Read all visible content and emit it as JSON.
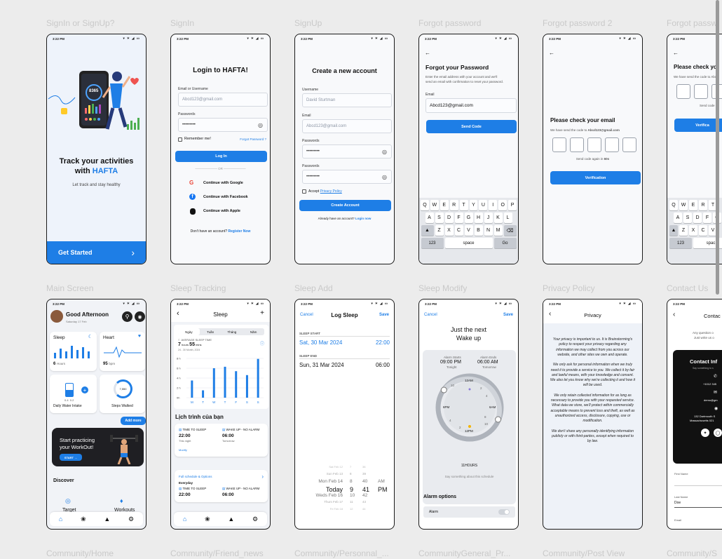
{
  "frames": {
    "f1": "SignIn or SignUp?",
    "f2": "SignIn",
    "f3": "SignUp",
    "f4": "Forgot password",
    "f5": "Forgot password 2",
    "f6": "Forgot passw",
    "f7": "Main Screen",
    "f8": "Sleep Tracking",
    "f9": "Sleep Add",
    "f10": "Sleep Modify",
    "f11": "Privacy Policy",
    "f12": "Contact Us",
    "b1": "Community/Home",
    "b2": "Community/Friend_news",
    "b3": "Community/Personnal_...",
    "b4": "CommunityGeneral_Pr...",
    "b5": "Community/Post View",
    "b6": "Community/S"
  },
  "status": {
    "time": "3:22 PM",
    "icons": "▾ ✶ ◢ ▭"
  },
  "welcome": {
    "watch_num": "8365",
    "title1": "Track your activities",
    "title2": "with",
    "brand": "HAFTA",
    "subtitle": "Let track and stay healthy",
    "cta": "Get Started",
    "cta_arrow": "›"
  },
  "signin": {
    "title": "Login to HAFTA!",
    "email_label": "Email or Username",
    "email_value": "Abcd123@gmail.com",
    "pw_label": "Passwords",
    "pw_value": "•••••••••",
    "remember": "Remember me!",
    "forgot": "Forgot Password ?",
    "login": "Log In",
    "or": "OR",
    "google": "Continue with Google",
    "facebook": "Continue with Facebook",
    "apple": "Continue with Apple",
    "noacc": "Don't have an account?",
    "register": "Register Now"
  },
  "signup": {
    "title": "Create a new account",
    "username_label": "Username",
    "username_value": "David Sturtman",
    "email_label": "Email",
    "email_value": "Abcd123@gmail.com",
    "pw_label": "Passwords",
    "pw_value": "•••••••••",
    "pw2_label": "Passwords",
    "pw2_value": "•••••••••",
    "accept": "Accept",
    "privacy": "Privacy Policy",
    "create": "Create Account",
    "have": "Already have an account?",
    "login": "Login now"
  },
  "forgot": {
    "back": "←",
    "title": "Forgot your Password",
    "desc1": "Enter the email address with your account and we'll",
    "desc2": "send an email with confirmation to reset your password.",
    "email_label": "Email",
    "email_value": "Abcd123@gmail.com",
    "send": "Send Code"
  },
  "keyboard": {
    "row1": [
      "Q",
      "W",
      "E",
      "R",
      "T",
      "Y",
      "U",
      "I",
      "O",
      "P"
    ],
    "row2": [
      "A",
      "S",
      "D",
      "F",
      "G",
      "H",
      "J",
      "K",
      "L"
    ],
    "row3": [
      "Z",
      "X",
      "C",
      "V",
      "B",
      "N",
      "M"
    ],
    "shift": "▲",
    "del": "⌫",
    "num": "123",
    "space": "space",
    "go": "Go"
  },
  "forgot2": {
    "back": "←",
    "title": "Please check your email",
    "desc": "We have send the code to",
    "email": "Abcd123@gmail.com",
    "resend": "Send code again in",
    "secs": "60s",
    "verify": "Verification"
  },
  "forgot3": {
    "back": "←",
    "title": "Please check yo",
    "desc": "We have send the code to Abcd",
    "resend": "Send code ag",
    "verify": "Verifica",
    "row1": [
      "Q",
      "W",
      "E",
      "R",
      "T"
    ],
    "row2": [
      "A",
      "S",
      "D",
      "F",
      "G"
    ],
    "row3": [
      "Z",
      "X",
      "C",
      "V"
    ],
    "num": "123",
    "space": "spac"
  },
  "main": {
    "greet": "Good Afternoon",
    "date": "Saturday 17 Feb",
    "sleep": "Sleep",
    "sleep_val": "6",
    "sleep_unit": "Hours",
    "heart": "Heart",
    "heart_val": "95",
    "heart_unit": "bpm",
    "water_a": "0.4",
    "water_b": "0.2",
    "water": "Daily Water Intake",
    "steps_num": "7,550",
    "steps": "Steps Walked",
    "add_more": "Add more",
    "work1": "Start practicing",
    "work2": "your WorkOut!",
    "start": "START →",
    "discover": "Discover",
    "target": "Target",
    "workouts": "Workouts"
  },
  "nav": {
    "home": "⌂",
    "paw": "❀",
    "user": "▲",
    "gear": "⚙"
  },
  "sleep": {
    "back": "‹",
    "title": "Sleep",
    "add": "+",
    "tabs": [
      "Ngày",
      "Tuần",
      "Tháng",
      "Năm"
    ],
    "avg_label": "AVERAGE SLEEP TIME",
    "avg_h": "7",
    "hours": "hours",
    "avg_m": "55",
    "mins": "mins",
    "range": "24 - 30 Month, 2024",
    "yticks": [
      "8 h",
      "6 h",
      "4 h",
      "2 h",
      "0h"
    ],
    "xticks": [
      "M",
      "T",
      "W",
      "T",
      "F",
      "S",
      "S"
    ],
    "schedule_title": "Lịch trình của bạn",
    "c1_sleep": "TIME TO SLEEP",
    "c1_wake": "WAKE UP - NO ALARM",
    "c1_t1": "22:00",
    "c1_t2": "06:00",
    "c1_d1": "This night",
    "c1_d2": "Tomorrow",
    "modify": "Modify",
    "full": "Full schedule & Options",
    "everyday": "Everyday",
    "c2_t1": "22:00",
    "c2_t2": "06:00"
  },
  "sleep_chart": {
    "type": "bar",
    "categories": [
      "M",
      "T",
      "W",
      "T",
      "F",
      "S",
      "S"
    ],
    "values": [
      3.5,
      1.5,
      6.0,
      6.3,
      5.4,
      4.6,
      7.9
    ],
    "ylim": [
      0,
      8
    ]
  },
  "sleepadd": {
    "cancel": "Cancel",
    "title": "Log Sleep",
    "save": "Save",
    "start_label": "SLEEP START",
    "start_date": "Sat, 30 Mar 2024",
    "start_time": "22:00",
    "end_label": "SLEEP END",
    "end_date": "Sun, 31 Mar 2024",
    "end_time": "06:00",
    "picker": [
      [
        "Sat Feb 12",
        "7",
        "38",
        ""
      ],
      [
        "Sun Feb 13",
        "8",
        "39",
        ""
      ],
      [
        "Mon Feb 14",
        "8",
        "40",
        "AM"
      ],
      [
        "Today",
        "9",
        "41",
        "PM"
      ],
      [
        "Weds Feb 16",
        "10",
        "42",
        ""
      ],
      [
        "Thurs Feb 17",
        "11",
        "43",
        ""
      ],
      [
        "Fri Feb 18",
        "12",
        "44",
        ""
      ]
    ]
  },
  "sleepmod": {
    "cancel": "Cancel",
    "save": "Save",
    "title1": "Just the next",
    "title2": "Wake up",
    "a_starts": "Alarm Starts",
    "a_ends": "Alarm Ends",
    "start_t": "09:00 PM",
    "end_t": "06:00 AM",
    "tonight": "Tonight",
    "tomorrow": "Tomorrow",
    "n12am": "12AM",
    "n12pm": "12PM",
    "n6pm": "6PM",
    "n6am": "6AM",
    "n10": "10",
    "n2": "2",
    "n4": "4",
    "n8": "8",
    "hours": "11HOURS",
    "note": "Say something about this schedule",
    "options": "Alarm options",
    "alarm": "Alarm"
  },
  "privacy": {
    "back": "‹",
    "title": "Privacy",
    "p1": "Your privacy is important to us. It is Brainstorming's policy to respect your privacy regarding any information we may collect from you across our website, and other sites we own and operate.",
    "p2": "We only ask for personal information when we truly need it to provide a service to you. We collect it by fair and lawful means, with your knowledge and consent. We also let you know why we're collecting it and how it will be used.",
    "p3": "We only retain collected information for as long as necessary to provide you with your requested service. What data we store, we'll protect within commercially acceptable means to prevent loss and theft, as well as unauthorized access, disclosure, copying, use or modification.",
    "p4": "We don't share any personally identifying information publicly or with third-parties, except when required to by law."
  },
  "contact": {
    "back": "‹",
    "title": "Contac",
    "q1": "Any question o",
    "q2": "Just write us o",
    "info": "Contact Inf",
    "say": "Say something to s",
    "phone": "+1012 345",
    "email": "demo@gm",
    "addr1": "132 Dartmouth S",
    "addr2": "Massachusetts 021",
    "first": "First Name",
    "last": "Last Name",
    "last_val": "Doe",
    "email_lbl": "Email"
  },
  "colors": {
    "primary": "#1e7ee6",
    "dark": "#1f1f23"
  }
}
